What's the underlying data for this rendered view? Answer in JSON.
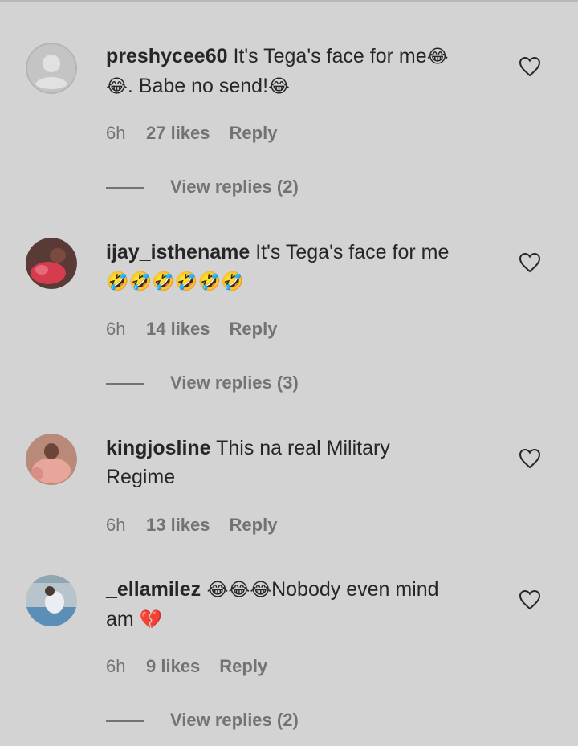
{
  "comments": [
    {
      "username": "preshycee60",
      "text_a": " It's Tega's face for me",
      "emoji_a": "😂",
      "line2_emoji": "😂",
      "text_b": ". Babe no send!",
      "emoji_b": "😂",
      "time": "6h",
      "likes": "27 likes",
      "reply": "Reply",
      "view_replies": "View replies (2)"
    },
    {
      "username": "ijay_isthename",
      "text_a": " It's Tega's face for me",
      "emojis": "🤣🤣🤣🤣🤣🤣",
      "time": "6h",
      "likes": "14 likes",
      "reply": "Reply",
      "view_replies": "View replies (3)"
    },
    {
      "username": "kingjosline",
      "text_a": " This na real Military",
      "text_b": "Regime",
      "time": "6h",
      "likes": "13 likes",
      "reply": "Reply"
    },
    {
      "username": "_ellamilez",
      "emoji_a": " 😂😂😂",
      "text_a": "Nobody even mind",
      "text_b": "am ",
      "emoji_b": "💔",
      "time": "6h",
      "likes": "9 likes",
      "reply": "Reply",
      "view_replies": "View replies (2)"
    }
  ]
}
